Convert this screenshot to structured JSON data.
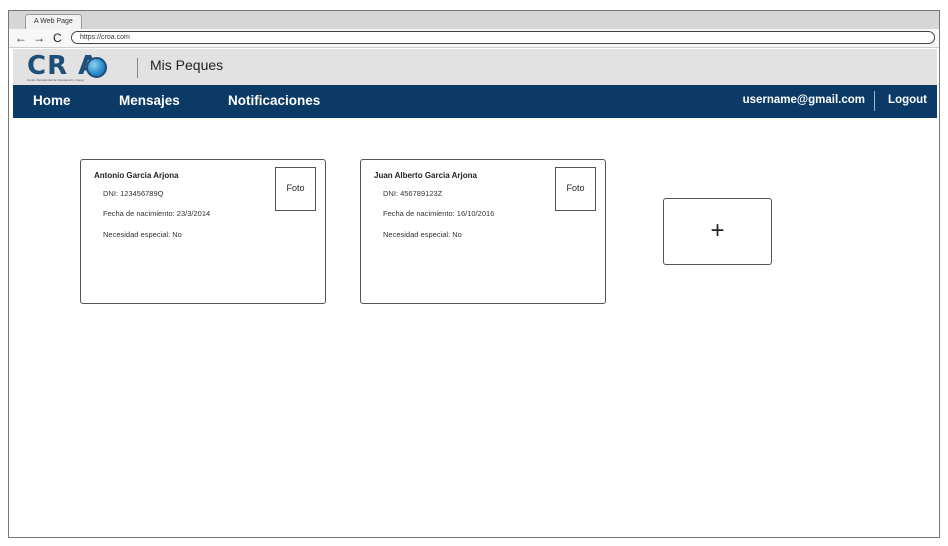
{
  "browser": {
    "tab_title": "A Web Page",
    "back_glyph": "←",
    "forward_glyph": "→",
    "reload_glyph": "C",
    "url": "https://croa.com"
  },
  "header": {
    "logo_text": "CR  A",
    "logo_subtitle": "Centro Residencial de Orientación y Apoyo",
    "app_title": "Mis Peques"
  },
  "nav": {
    "items": [
      {
        "label": "Home"
      },
      {
        "label": "Mensajes"
      },
      {
        "label": "Notificaciones"
      }
    ],
    "user_email": "username@gmail.com",
    "logout_label": "Logout"
  },
  "children": [
    {
      "name": "Antonio Garcia Arjona",
      "dni": "DNI: 123456789Q",
      "birth": "Fecha de nacimiento: 23/3/2014",
      "special": "Necesidad especial: No",
      "photo_label": "Foto"
    },
    {
      "name": "Juan Alberto Garcia Arjona",
      "dni": "DNI: 456789123Z",
      "birth": "Fecha de nacimiento: 16/10/2016",
      "special": "Necesidad especial: No",
      "photo_label": "Foto"
    }
  ],
  "add_button": {
    "label": "+"
  }
}
